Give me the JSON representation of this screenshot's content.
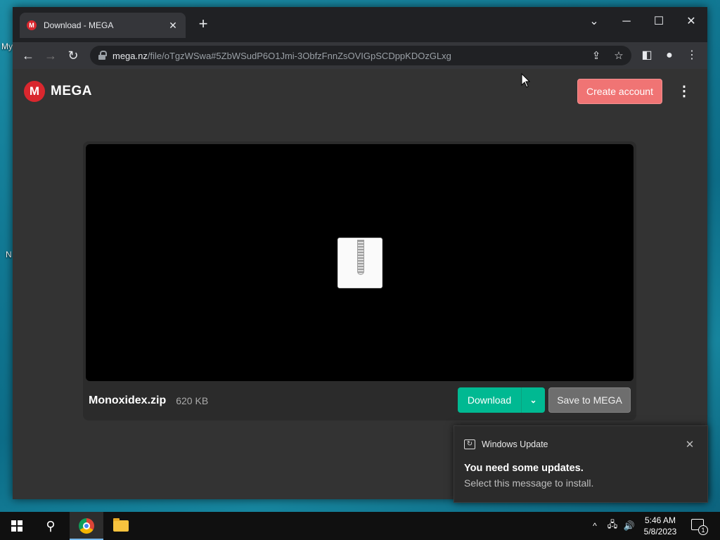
{
  "desktop": {
    "fragments": [
      "My",
      "N"
    ]
  },
  "browser": {
    "tab": {
      "title": "Download - MEGA",
      "favicon": "M"
    },
    "address": {
      "host": "mega.nz",
      "path": "/file/oTgzWSwa#5ZbWSudP6O1Jmi-3ObfzFnnZsOVIGpSCDppKDOzGLxg"
    }
  },
  "page": {
    "logo_letter": "M",
    "logo_text": "MEGA",
    "create_account_label": "Create account",
    "file": {
      "name": "Monoxidex.zip",
      "size": "620 KB"
    },
    "download_label": "Download",
    "save_label": "Save to MEGA"
  },
  "toast": {
    "app_name": "Windows Update",
    "title": "You need some updates.",
    "body": "Select this message to install."
  },
  "taskbar": {
    "time": "5:46 AM",
    "date": "5/8/2023",
    "notification_count": "1"
  },
  "colors": {
    "mega_red": "#d9272e",
    "create_account": "#f07474",
    "download_green": "#00b992",
    "save_gray": "#6e6e6e"
  }
}
